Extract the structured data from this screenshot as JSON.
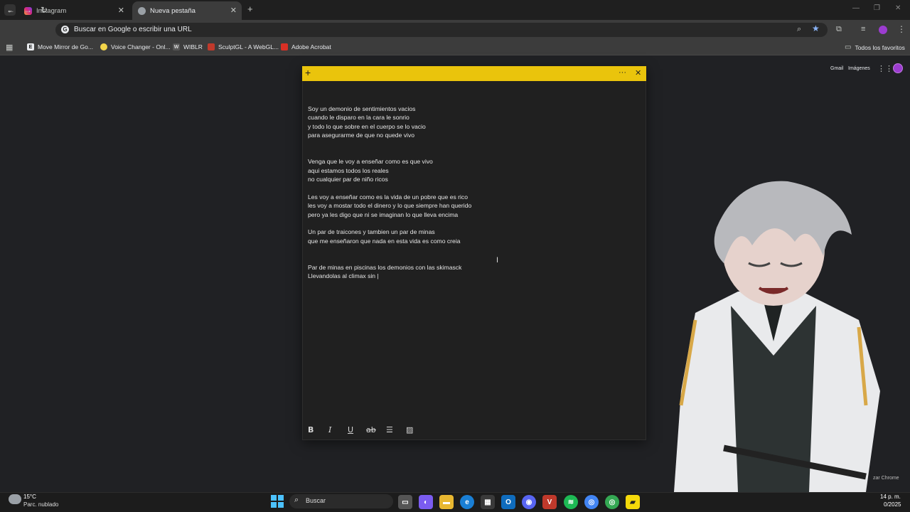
{
  "browser": {
    "tabs": [
      {
        "label": "Instagram",
        "active": false
      },
      {
        "label": "Nueva pestaña",
        "active": true
      }
    ],
    "new_tab": "+",
    "omnibox_placeholder": "Buscar en Google o escribir una URL",
    "bookmarks": [
      {
        "label": "Move Mirror de Go...",
        "icon": "E"
      },
      {
        "label": "Voice Changer - Onl...",
        "icon": ""
      },
      {
        "label": "WIBLR",
        "icon": "W"
      },
      {
        "label": "SculptGL - A WebGL...",
        "icon": ""
      },
      {
        "label": "Adobe Acrobat",
        "icon": ""
      }
    ],
    "all_bookmarks": "Todos los favoritos"
  },
  "google": {
    "gmail": "Gmail",
    "images": "Imágenes"
  },
  "note": {
    "lines": [
      "Soy un demonio de sentimientos vacios",
      "cuando le disparo en la cara le sonrio",
      "y todo lo que sobre en el cuerpo se lo vacio",
      "para asegurarme de que no quede vivo",
      "",
      "",
      "Venga que le voy a enseñar como es que vivo",
      "aqui estamos todos los reales",
      "no cualquier par de niño ricos",
      "",
      "Les voy a enseñar como es la vida de un pobre que es rico",
      "les voy a mostar todo el dinero y lo que siempre han querido",
      "pero ya les digo que ni se imaginan lo que lleva encima",
      "",
      "Un par de traicones y tambien un par de minas",
      "que me enseñaron que nada en esta vida es como creia",
      "",
      "",
      "Par de minas en piscinas los demonios con las skimasck",
      "Llevandolas al climax sin |"
    ],
    "toolbar": {
      "bold": "B",
      "italic": "I",
      "underline": "U",
      "strike": "ab"
    }
  },
  "overlay_text": "zar Chrome",
  "taskbar": {
    "weather_temp": "15°C",
    "weather_desc": "Parc. nublado",
    "search": "Buscar",
    "time": "14 p. m.",
    "date": "0/2025"
  },
  "colors": {
    "note_header": "#eac40c",
    "page_bg": "#202124"
  }
}
